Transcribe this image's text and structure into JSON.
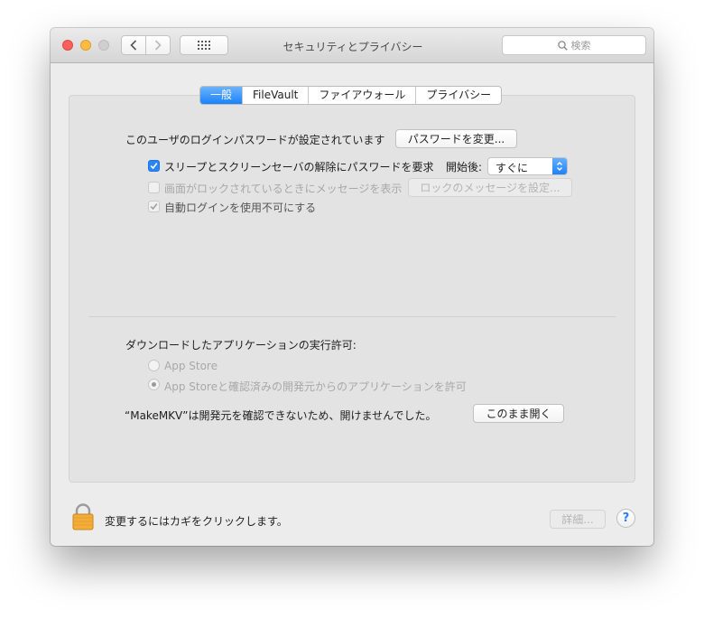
{
  "window": {
    "title": "セキュリティとプライバシー"
  },
  "search": {
    "placeholder": "検索"
  },
  "tabs": [
    {
      "label": "一般",
      "active": true
    },
    {
      "label": "FileVault",
      "active": false
    },
    {
      "label": "ファイアウォール",
      "active": false
    },
    {
      "label": "プライバシー",
      "active": false
    }
  ],
  "general": {
    "password_text": "このユーザのログインパスワードが設定されています",
    "change_password_button": "パスワードを変更...",
    "require_password": {
      "label": "スリープとスクリーンセーバの解除にパスワードを要求",
      "checked": true
    },
    "after_label": "開始後:",
    "after_value": "すぐに",
    "show_message": {
      "label": "画面がロックされているときにメッセージを表示",
      "checked": false
    },
    "set_lock_message_button": "ロックのメッセージを設定...",
    "disable_auto_login": {
      "label": "自動ログインを使用不可にする",
      "checked": true
    },
    "allow_apps_heading": "ダウンロードしたアプリケーションの実行許可:",
    "radio_options": [
      {
        "label": "App Store",
        "selected": false
      },
      {
        "label": "App Storeと確認済みの開発元からのアプリケーションを許可",
        "selected": true
      }
    ],
    "blocked_message": "“MakeMKV”は開発元を確認できないため、開けませんでした。",
    "open_anyway_button": "このまま開く"
  },
  "footer": {
    "lock_text": "変更するにはカギをクリックします。",
    "advanced_button": "詳細...",
    "help_label": "?"
  },
  "colors": {
    "accent": "#1a82fb",
    "window_bg": "#ececec",
    "panel_bg": "#e3e3e3"
  },
  "icons": [
    "back-arrow-icon",
    "forward-arrow-icon",
    "grid-icon",
    "search-icon",
    "lock-icon",
    "checkmark-icon",
    "popup-arrows-icon"
  ]
}
